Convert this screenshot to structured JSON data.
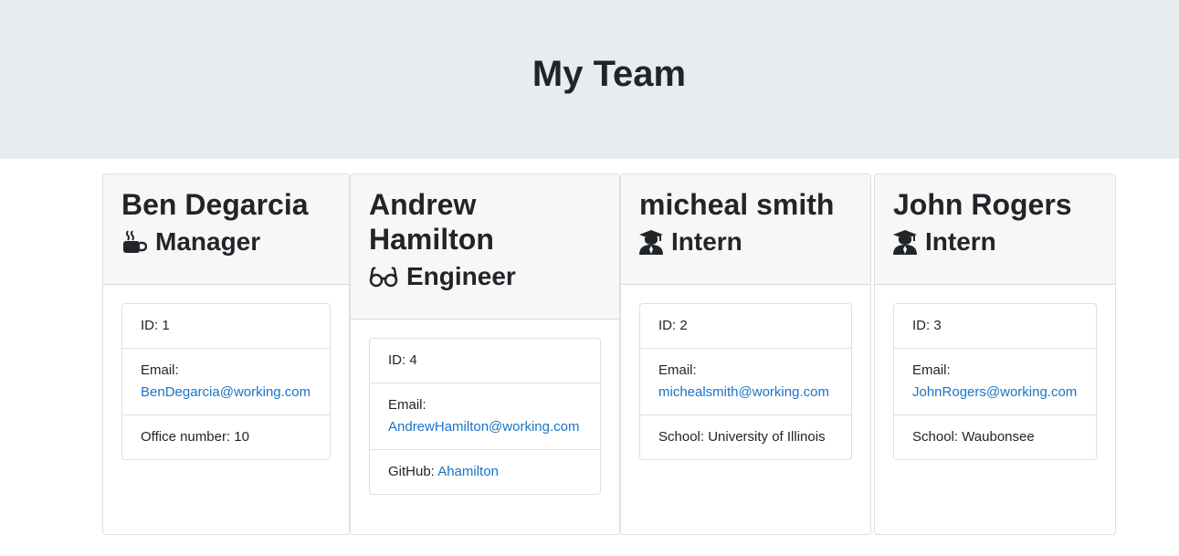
{
  "header": {
    "title": "My Team"
  },
  "colors": {
    "jumbotron": "#e9ecef",
    "link": "#1a73c8",
    "header_bg": "#f7f7f7"
  },
  "cards": [
    {
      "name": "Ben Degarcia",
      "role": "Manager",
      "role_icon": "coffee-mug-icon",
      "id": "ID: 1",
      "email_label": "Email:",
      "email": "BenDegarcia@working.com",
      "extra_label": "Office number: 10",
      "extra_link": ""
    },
    {
      "name": "Andrew Hamilton",
      "role": "Engineer",
      "role_icon": "glasses-icon",
      "id": "ID: 4",
      "email_label": "Email:",
      "email": "AndrewHamilton@working.com",
      "extra_label": "GitHub: ",
      "extra_link": "Ahamilton"
    },
    {
      "name": "micheal smith",
      "role": "Intern",
      "role_icon": "graduate-icon",
      "id": "ID: 2",
      "email_label": "Email:",
      "email": "michealsmith@working.com",
      "extra_label": "School: University of Illinois",
      "extra_link": ""
    },
    {
      "name": "John Rogers",
      "role": "Intern",
      "role_icon": "graduate-icon",
      "id": "ID: 3",
      "email_label": "Email:",
      "email": "JohnRogers@working.com",
      "extra_label": "School: Waubonsee",
      "extra_link": ""
    }
  ]
}
